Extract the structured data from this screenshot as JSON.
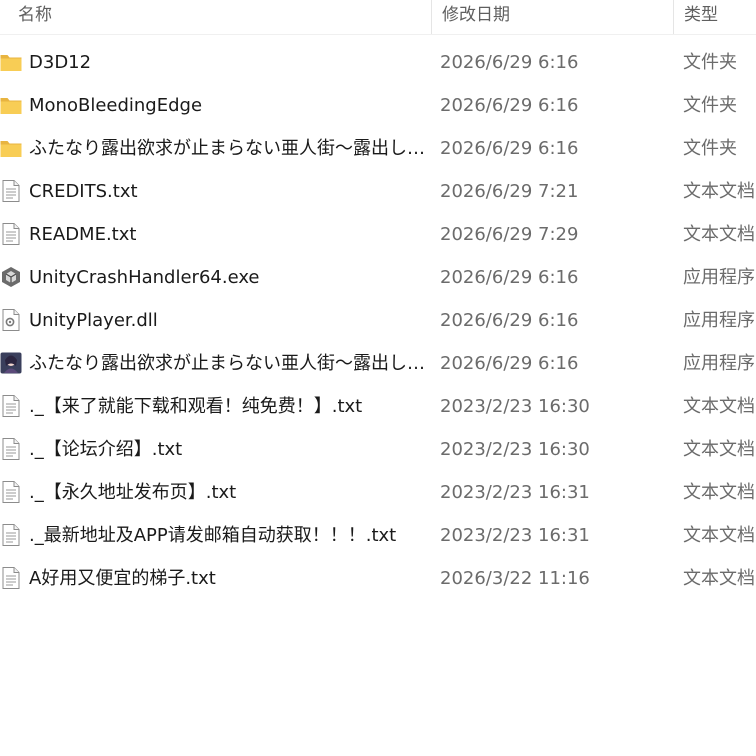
{
  "header": {
    "name": "名称",
    "date": "修改日期",
    "type": "类型"
  },
  "files": [
    {
      "name": "D3D12",
      "date": "2026/6/29 6:16",
      "type": "文件夹",
      "icon": "folder-icon"
    },
    {
      "name": "MonoBleedingEdge",
      "date": "2026/6/29 6:16",
      "type": "文件夹",
      "icon": "folder-icon"
    },
    {
      "name": "ふたなり露出欲求が止まらない亜人街～露出し…",
      "date": "2026/6/29 6:16",
      "type": "文件夹",
      "icon": "folder-icon"
    },
    {
      "name": "CREDITS.txt",
      "date": "2026/6/29 7:21",
      "type": "文本文档",
      "icon": "text-file-icon"
    },
    {
      "name": "README.txt",
      "date": "2026/6/29 7:29",
      "type": "文本文档",
      "icon": "text-file-icon"
    },
    {
      "name": "UnityCrashHandler64.exe",
      "date": "2026/6/29 6:16",
      "type": "应用程序",
      "icon": "unity-exe-icon"
    },
    {
      "name": "UnityPlayer.dll",
      "date": "2026/6/29 6:16",
      "type": "应用程序",
      "icon": "dll-file-icon"
    },
    {
      "name": "ふたなり露出欲求が止まらない亜人街～露出し…",
      "date": "2026/6/29 6:16",
      "type": "应用程序",
      "icon": "game-exe-icon"
    },
    {
      "name": "._【来了就能下载和观看！纯免费！】.txt",
      "date": "2023/2/23 16:30",
      "type": "文本文档",
      "icon": "text-file-icon"
    },
    {
      "name": "._【论坛介绍】.txt",
      "date": "2023/2/23 16:30",
      "type": "文本文档",
      "icon": "text-file-icon"
    },
    {
      "name": "._【永久地址发布页】.txt",
      "date": "2023/2/23 16:31",
      "type": "文本文档",
      "icon": "text-file-icon"
    },
    {
      "name": "._最新地址及APP请发邮箱自动获取！！！.txt",
      "date": "2023/2/23 16:31",
      "type": "文本文档",
      "icon": "text-file-icon"
    },
    {
      "name": "A好用又便宜的梯子.txt",
      "date": "2026/3/22 11:16",
      "type": "文本文档",
      "icon": "text-file-icon"
    }
  ]
}
